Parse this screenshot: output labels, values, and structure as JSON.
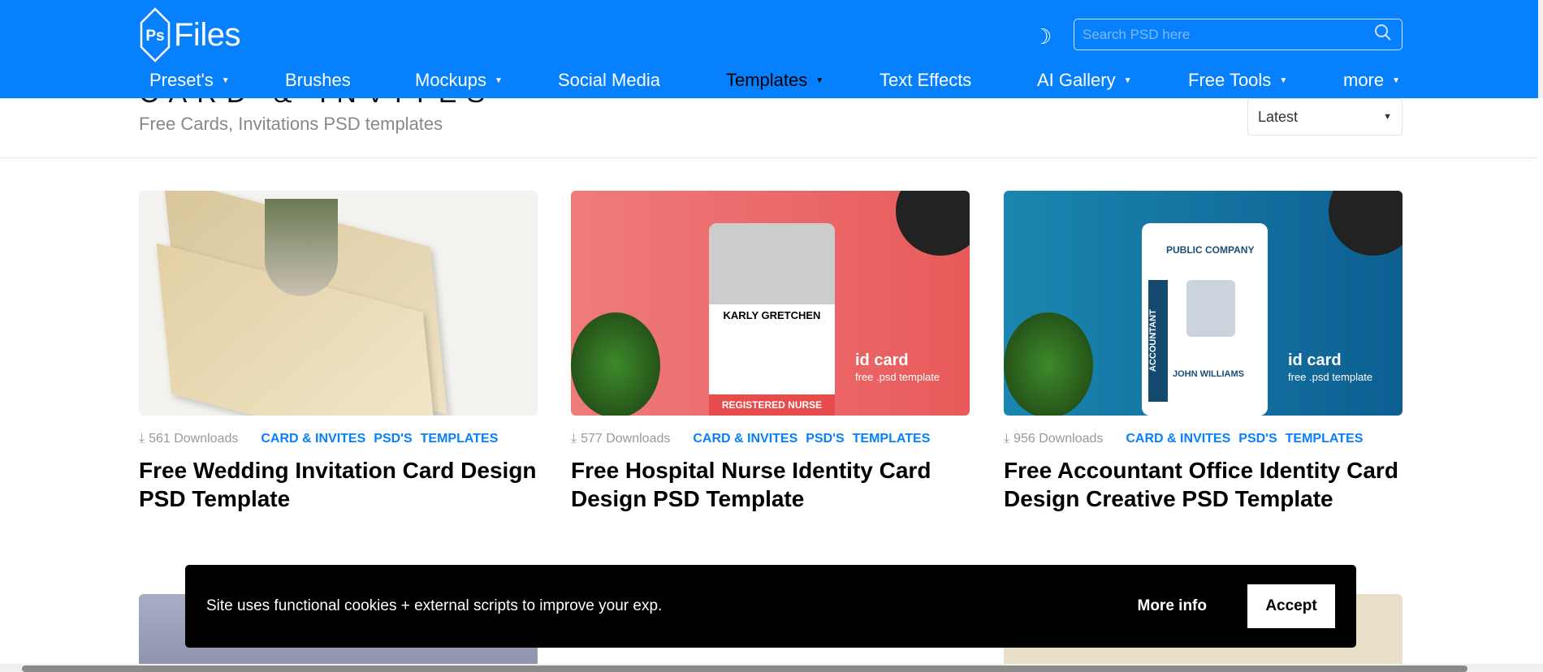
{
  "header": {
    "logo_text": "Files",
    "logo_mark": "Ps",
    "search_placeholder": "Search PSD here",
    "nav": [
      {
        "label": "Preset's",
        "caret": true
      },
      {
        "label": "Brushes",
        "caret": false
      },
      {
        "label": "Mockups",
        "caret": true
      },
      {
        "label": "Social Media",
        "caret": false
      },
      {
        "label": "Templates",
        "caret": true,
        "active": true
      },
      {
        "label": "Text Effects",
        "caret": false
      },
      {
        "label": "AI Gallery",
        "caret": true
      },
      {
        "label": "Free Tools",
        "caret": true
      },
      {
        "label": "more",
        "caret": true
      }
    ]
  },
  "page": {
    "title": "CARD & INVITES",
    "subtitle": "Free Cards, Invitations PSD templates",
    "sort": "Latest"
  },
  "cards": [
    {
      "downloads": "561 Downloads",
      "tags": [
        "CARD & INVITES",
        "PSD'S",
        "TEMPLATES"
      ],
      "title": "Free Wedding Invitation Card Design PSD Template"
    },
    {
      "downloads": "577 Downloads",
      "tags": [
        "CARD & INVITES",
        "PSD'S",
        "TEMPLATES"
      ],
      "title": "Free Hospital Nurse Identity Card Design PSD Template",
      "image_text": {
        "name": "KARLY GRETCHEN",
        "role": "REGISTERED NURSE",
        "caption": "id card",
        "sub": "free .psd template"
      }
    },
    {
      "downloads": "956 Downloads",
      "tags": [
        "CARD & INVITES",
        "PSD'S",
        "TEMPLATES"
      ],
      "title": "Free Accountant Office Identity Card Design Creative PSD Template",
      "image_text": {
        "company": "PUBLIC COMPANY",
        "name": "JOHN WILLIAMS",
        "vertical": "ACCOUNTANT",
        "caption": "id card",
        "sub": "free .psd template"
      }
    }
  ],
  "cookie": {
    "message": "Site uses functional cookies + external scripts to improve your exp.",
    "more_info": "More info",
    "accept": "Accept"
  },
  "colors": {
    "brand": "#0780fe"
  }
}
